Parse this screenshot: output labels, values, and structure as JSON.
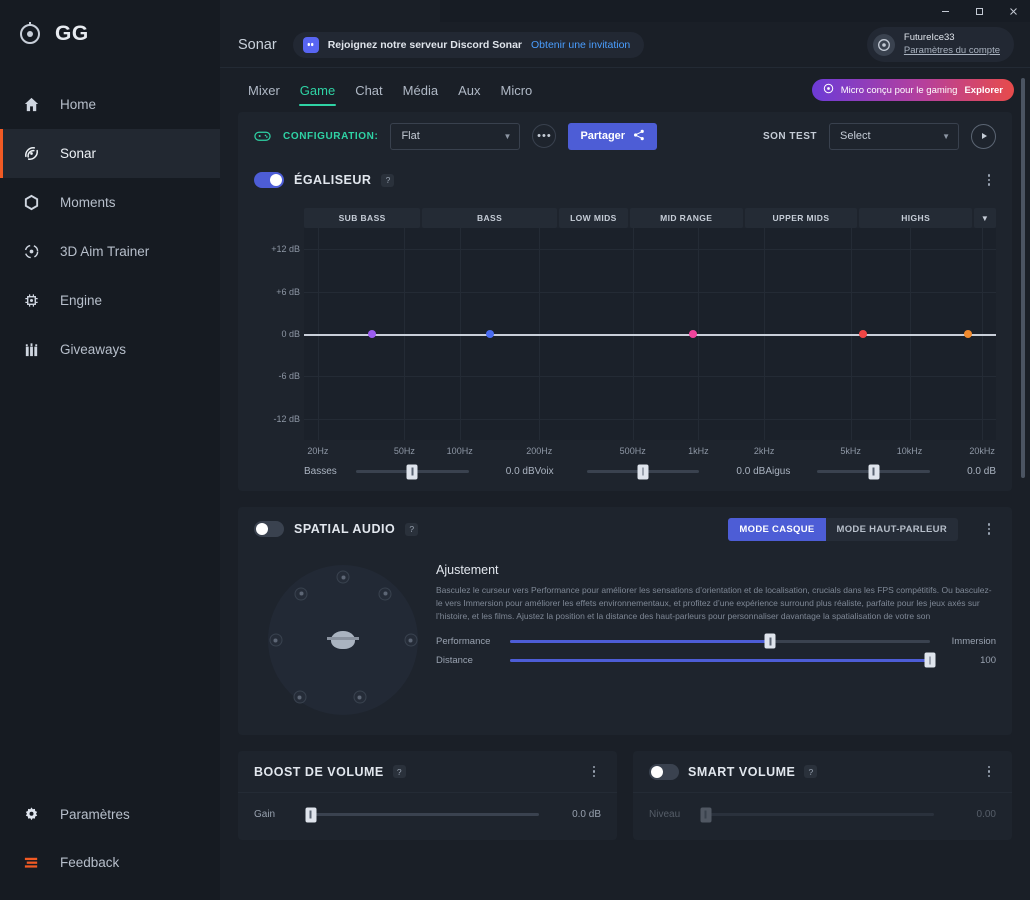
{
  "window": {
    "minimize": "–",
    "maximize": "□",
    "close": "✕"
  },
  "sidebar": {
    "brand": "GG",
    "items": [
      {
        "label": "Home",
        "icon": "home-icon"
      },
      {
        "label": "Sonar",
        "icon": "sonar-icon"
      },
      {
        "label": "Moments",
        "icon": "hexagon-icon"
      },
      {
        "label": "3D Aim Trainer",
        "icon": "target-icon"
      },
      {
        "label": "Engine",
        "icon": "chip-icon"
      },
      {
        "label": "Giveaways",
        "icon": "gift-icon"
      }
    ],
    "bottom_items": [
      {
        "label": "Paramètres",
        "icon": "gear-icon"
      },
      {
        "label": "Feedback",
        "icon": "feedback-icon"
      }
    ],
    "active_item": "Sonar",
    "accent": "#f15a24"
  },
  "header": {
    "title": "Sonar",
    "discord_text": "Rejoignez notre serveur Discord Sonar",
    "discord_link": "Obtenir une invitation",
    "account_name": "FutureIce33",
    "account_settings": "Paramètres du compte"
  },
  "tabs": {
    "items": [
      "Mixer",
      "Game",
      "Chat",
      "Média",
      "Aux",
      "Micro"
    ],
    "active": "Game",
    "active_color": "#2fd3a5"
  },
  "promo": {
    "text": "Micro conçu pour le gaming",
    "cta": "Explorer"
  },
  "config": {
    "label": "CONFIGURATION:",
    "preset_value": "Flat",
    "more_label": "•••",
    "share_label": "Partager",
    "sound_test_label": "SON TEST",
    "sound_test_value": "Select"
  },
  "equalizer": {
    "title": "ÉGALISEUR",
    "help": "?",
    "enabled": true,
    "bands": [
      "SUB BASS",
      "BASS",
      "LOW MIDS",
      "MID RANGE",
      "UPPER MIDS",
      "HIGHS"
    ],
    "sliders": [
      {
        "name": "Basses",
        "value": "0.0 dB",
        "pos": 50
      },
      {
        "name": "Voix",
        "value": "0.0 dB",
        "pos": 50
      },
      {
        "name": "Aigus",
        "value": "0.0 dB",
        "pos": 50
      }
    ]
  },
  "chart_data": {
    "type": "line",
    "title": "ÉGALISEUR",
    "xlabel": "",
    "ylabel": "dB",
    "x_ticks": [
      "20Hz",
      "50Hz",
      "100Hz",
      "200Hz",
      "500Hz",
      "1kHz",
      "2kHz",
      "5kHz",
      "10kHz",
      "20kHz"
    ],
    "x_tick_pct": [
      2.0,
      14.5,
      22.5,
      34.0,
      47.5,
      57.0,
      66.5,
      79.0,
      87.5,
      98.0
    ],
    "y_ticks": [
      "+12 dB",
      "+6 dB",
      "0 dB",
      "-6 dB",
      "-12 dB"
    ],
    "y_values": [
      12,
      6,
      0,
      -6,
      -12
    ],
    "ylim": [
      -15,
      15
    ],
    "series": [
      {
        "name": "EQ Response",
        "color": "#c9cfd9",
        "values": [
          0,
          0,
          0,
          0,
          0,
          0,
          0,
          0,
          0,
          0
        ]
      }
    ],
    "control_points": [
      {
        "freq": "35Hz",
        "gain": 0,
        "x_pct": 9.8,
        "color": "#9b5cf0"
      },
      {
        "freq": "120Hz",
        "gain": 0,
        "x_pct": 26.9,
        "color": "#4a6cf0"
      },
      {
        "freq": "900Hz",
        "gain": 0,
        "x_pct": 56.2,
        "color": "#f0439b"
      },
      {
        "freq": "6kHz",
        "gain": 0,
        "x_pct": 80.8,
        "color": "#f04545"
      },
      {
        "freq": "18kHz",
        "gain": 0,
        "x_pct": 95.9,
        "color": "#f08a2e"
      }
    ],
    "grid": true,
    "legend": "none"
  },
  "spatial": {
    "title": "SPATIAL AUDIO",
    "help": "?",
    "enabled": false,
    "mode_headphone": "MODE CASQUE",
    "mode_speaker": "MODE HAUT-PARLEUR",
    "active_mode": "MODE CASQUE",
    "adjust_title": "Ajustement",
    "adjust_desc": "Basculez le curseur vers Performance pour améliorer les sensations d’orientation et de localisation, crucials dans les FPS compétitifs. Ou basculez-le vers Immersion pour améliorer les effets environnementaux, et profitez d’une expérience surround plus réaliste, parfaite pour les jeux axés sur l’histoire, et les films. Ajustez la position et la distance des haut-parleurs pour personnaliser davantage la spatialisation de votre son",
    "perf_label": "Performance",
    "immersion_label": "Immersion",
    "perf_pos": 62,
    "distance_label": "Distance",
    "distance_value": "100",
    "distance_pos": 100,
    "speakers": 7
  },
  "volume_boost": {
    "title": "BOOST DE VOLUME",
    "help": "?",
    "gain_label": "Gain",
    "gain_value": "0.0 dB",
    "gain_pos": 2
  },
  "smart_volume": {
    "title": "SMART VOLUME",
    "help": "?",
    "enabled": false,
    "level_label": "Niveau",
    "level_value": "0.00",
    "level_pos": 2
  }
}
